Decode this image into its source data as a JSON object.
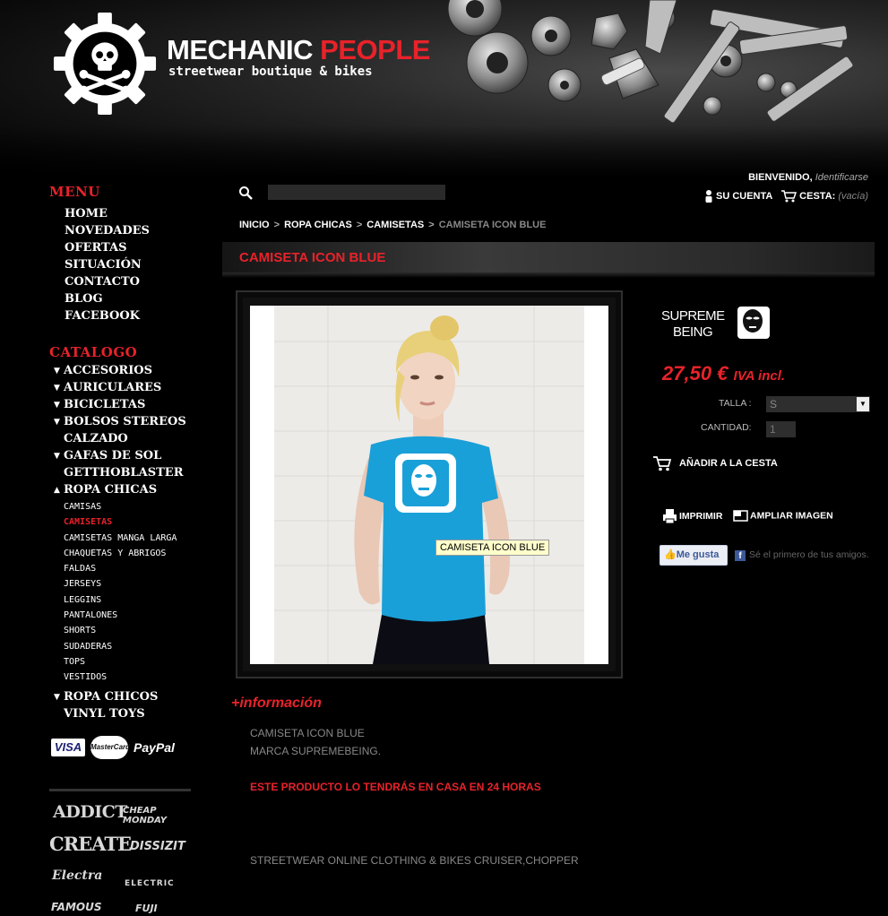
{
  "header": {
    "logo_title_main": "MECHANIC ",
    "logo_title_accent": "PEOPLE",
    "logo_subtitle": "streetwear boutique & bikes"
  },
  "topbar": {
    "search_placeholder": "",
    "welcome": "BIENVENIDO,",
    "login_link": "Identificarse",
    "account_label": "SU CUENTA",
    "cart_label": "CESTA:",
    "cart_status": "(vacía)"
  },
  "sidebar": {
    "menu_heading": "MENU",
    "menu_items": [
      "HOME",
      "NOVEDADES",
      "OFERTAS",
      "SITUACIÓN",
      "CONTACTO",
      "BLOG",
      "FACEBOOK"
    ],
    "catalog_heading": "CATALOGO",
    "categories": [
      {
        "label": "ACCESORIOS",
        "arrow": "▼"
      },
      {
        "label": "AURICULARES",
        "arrow": "▼"
      },
      {
        "label": "BICICLETAS",
        "arrow": "▼"
      },
      {
        "label": "BOLSOS STEREOS",
        "arrow": "▼"
      },
      {
        "label": "CALZADO",
        "arrow": ""
      },
      {
        "label": "GAFAS DE SOL",
        "arrow": "▼"
      },
      {
        "label": "GETTHOBLASTER",
        "arrow": ""
      },
      {
        "label": "ROPA CHICAS",
        "arrow": "▲"
      }
    ],
    "subcategories": [
      "CAMISAS",
      "CAMISETAS",
      "CAMISETAS MANGA LARGA",
      "CHAQUETAS Y ABRIGOS",
      "FALDAS",
      "JERSEYS",
      "LEGGINS",
      "PANTALONES",
      "SHORTS",
      "SUDADERAS",
      "TOPS",
      "VESTIDOS"
    ],
    "active_subcategory": "CAMISETAS",
    "categories_after": [
      {
        "label": "ROPA CHICOS",
        "arrow": "▼"
      },
      {
        "label": "VINYL TOYS",
        "arrow": ""
      }
    ],
    "payment": {
      "visa": "VISA",
      "mastercard": "MasterCard",
      "paypal": "PayPal"
    },
    "brands": [
      "ADDICT",
      "CHEAP MONDAY",
      "CREATE",
      "DISSIZIT",
      "Electra",
      "ELECTRIC",
      "FAMOUS",
      "FUJI"
    ]
  },
  "breadcrumb": {
    "items": [
      "INICIO",
      "ROPA CHICAS",
      "CAMISETAS"
    ],
    "current": "CAMISETA ICON BLUE"
  },
  "product": {
    "title": "CAMISETA ICON BLUE",
    "image_tooltip": "CAMISETA ICON BLUE",
    "brand_logo_text": "SUPREME BEING",
    "price": "27,50 €",
    "price_suffix": "IVA incl.",
    "size_label": "TALLA :",
    "size_value": "S",
    "quantity_label": "CANTIDAD:",
    "quantity_value": "1",
    "add_to_cart": "AÑADIR A LA CESTA",
    "print": "IMPRIMIR",
    "enlarge": "AMPLIAR IMAGEN",
    "like_button": "Me gusta",
    "like_text": "Sé el primero de tus amigos.",
    "tshirt_color": "#1aa0d8"
  },
  "info": {
    "heading": "+información",
    "line1": "CAMISETA ICON BLUE",
    "line2": "MARCA SUPREMEBEING.",
    "shipping": "ESTE PRODUCTO LO TENDRÁS EN CASA EN 24 HORAS",
    "footer_line": "STREETWEAR ONLINE CLOTHING & BIKES CRUISER,CHOPPER"
  }
}
